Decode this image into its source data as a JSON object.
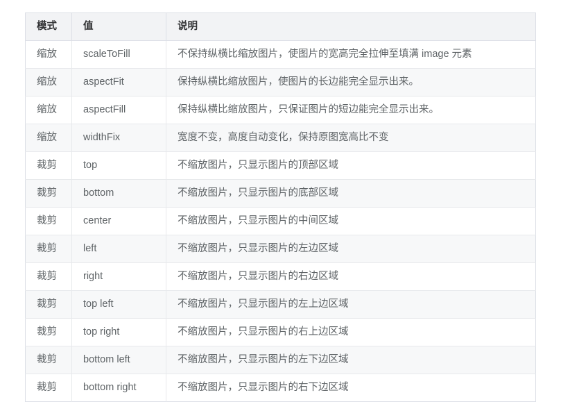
{
  "table": {
    "columns": [
      {
        "key": "mode",
        "label": "模式"
      },
      {
        "key": "value",
        "label": "值"
      },
      {
        "key": "desc",
        "label": "说明"
      }
    ],
    "rows": [
      {
        "mode": "缩放",
        "value": "scaleToFill",
        "desc": "不保持纵横比缩放图片，使图片的宽高完全拉伸至填满 image 元素"
      },
      {
        "mode": "缩放",
        "value": "aspectFit",
        "desc": "保持纵横比缩放图片，使图片的长边能完全显示出来。"
      },
      {
        "mode": "缩放",
        "value": "aspectFill",
        "desc": "保持纵横比缩放图片，只保证图片的短边能完全显示出来。"
      },
      {
        "mode": "缩放",
        "value": "widthFix",
        "desc": "宽度不变，高度自动变化，保持原图宽高比不变"
      },
      {
        "mode": "裁剪",
        "value": "top",
        "desc": "不缩放图片，只显示图片的顶部区域"
      },
      {
        "mode": "裁剪",
        "value": "bottom",
        "desc": "不缩放图片，只显示图片的底部区域"
      },
      {
        "mode": "裁剪",
        "value": "center",
        "desc": "不缩放图片，只显示图片的中间区域"
      },
      {
        "mode": "裁剪",
        "value": "left",
        "desc": "不缩放图片，只显示图片的左边区域"
      },
      {
        "mode": "裁剪",
        "value": "right",
        "desc": "不缩放图片，只显示图片的右边区域"
      },
      {
        "mode": "裁剪",
        "value": "top left",
        "desc": "不缩放图片，只显示图片的左上边区域"
      },
      {
        "mode": "裁剪",
        "value": "top right",
        "desc": "不缩放图片，只显示图片的右上边区域"
      },
      {
        "mode": "裁剪",
        "value": "bottom left",
        "desc": "不缩放图片，只显示图片的左下边区域"
      },
      {
        "mode": "裁剪",
        "value": "bottom right",
        "desc": "不缩放图片，只显示图片的右下边区域"
      }
    ]
  },
  "colors": {
    "header_background": "#f2f3f5",
    "header_text": "#303133",
    "body_text": "#5e6366",
    "border": "#dcdfe6",
    "stripe_background": "#f7f8f9",
    "page_background": "#ffffff"
  }
}
